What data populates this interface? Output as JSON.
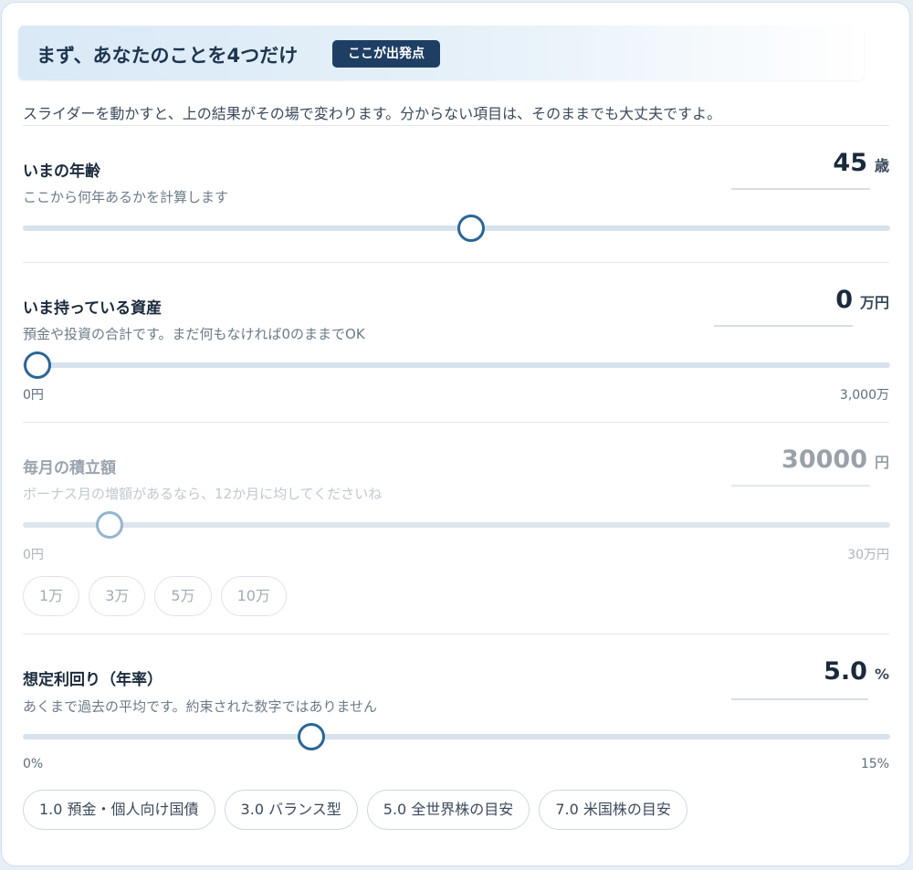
{
  "header": {
    "title": "まず、あなたのことを4つだけ",
    "badge": "ここが出発点"
  },
  "intro": "スライダーを動かすと、上の結果がその場で変わります。分からない項目は、そのままでも大丈夫ですよ。",
  "age": {
    "label": "いまの年齢",
    "hint": "ここから何年あるかを計算します",
    "value": "45",
    "unit": "歳",
    "slider_fraction": 0.517
  },
  "assets": {
    "label": "いま持っている資産",
    "hint": "預金や投資の合計です。まだ何もなければ0のままでOK",
    "value": "0",
    "unit": "万円",
    "min_label": "0円",
    "max_label": "3,000万",
    "slider_fraction": 0.0
  },
  "monthly": {
    "label": "毎月の積立額",
    "hint": "ボーナス月の増額があるなら、12か月に均してくださいね",
    "value": "30000",
    "unit": "円",
    "min_label": "0円",
    "max_label": "30万円",
    "slider_fraction": 0.1,
    "presets": [
      "1万",
      "3万",
      "5万",
      "10万"
    ]
  },
  "rate": {
    "label": "想定利回り（年率）",
    "hint": "あくまで過去の平均です。約束された数字ではありません",
    "value": "5.0",
    "unit": "%",
    "min_label": "0%",
    "max_label": "15%",
    "slider_fraction": 0.333,
    "presets": [
      "1.0 預金・個人向け国債",
      "3.0 バランス型",
      "5.0 全世界株の目安",
      "7.0 米国株の目安"
    ]
  },
  "colors": {
    "accent": "#2b6596",
    "badge_bg": "#1e3f63",
    "track": "#d7e2ec"
  }
}
